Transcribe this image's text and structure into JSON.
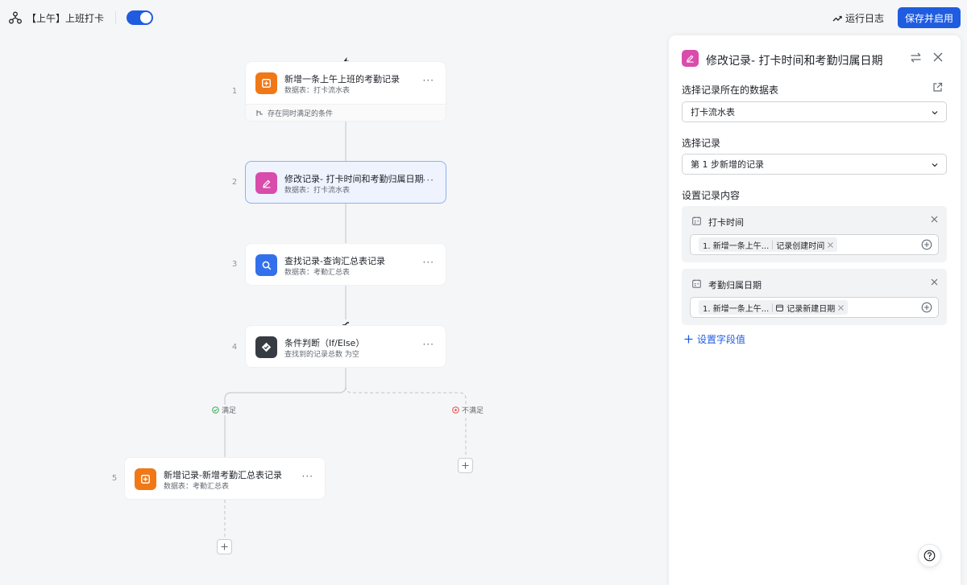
{
  "topbar": {
    "icon": "workflow-icon",
    "title": "【上午】上班打卡",
    "enabled": true,
    "run_log_label": "运行日志",
    "save_label": "保存并启用"
  },
  "canvas": {
    "nodes": [
      {
        "step": "1",
        "title": "新增一条上午上班的考勤记录",
        "subtitle": "数据表：打卡流水表",
        "icon": "add-record-icon",
        "color": "#f07817",
        "condition": "存在同时满足的条件",
        "trigger": "lightning-icon"
      },
      {
        "step": "2",
        "title": "修改记录- 打卡时间和考勤归属日期",
        "subtitle": "数据表：打卡流水表",
        "icon": "edit-record-icon",
        "color": "#d94cac",
        "selected": true
      },
      {
        "step": "3",
        "title": "查找记录-查询汇总表记录",
        "subtitle": "数据表：考勤汇总表",
        "icon": "search-icon",
        "color": "#3370eb"
      },
      {
        "step": "4",
        "title": "条件判断（If/Else）",
        "subtitle": "查找到的记录总数 为空",
        "icon": "condition-icon",
        "color": "#373c43",
        "badge": "branch-icon"
      },
      {
        "step": "5",
        "title": "新增记录-新增考勤汇总表记录",
        "subtitle": "数据表：考勤汇总表",
        "icon": "add-record-icon",
        "color": "#f07817"
      }
    ],
    "branches": {
      "yes_label": "满足",
      "no_label": "不满足"
    },
    "more_glyph": "···"
  },
  "panel": {
    "title": "修改记录- 打卡时间和考勤归属日期",
    "table_label": "选择记录所在的数据表",
    "table_value": "打卡流水表",
    "record_label": "选择记录",
    "record_value": "第 1 步新增的记录",
    "content_label": "设置记录内容",
    "fields": [
      {
        "name": "打卡时间",
        "tag_source": "1. 新增一条上午...",
        "tag_value": "记录创建时间"
      },
      {
        "name": "考勤归属日期",
        "tag_source": "1. 新增一条上午...",
        "tag_value": "记录新建日期"
      }
    ],
    "add_field_label": "设置字段值"
  },
  "colors": {
    "accent": "#1f5ce0",
    "orange": "#f07817",
    "pink": "#d94cac",
    "blue": "#3370eb",
    "dark": "#373c43",
    "success": "#34a853",
    "danger": "#e5483d"
  }
}
